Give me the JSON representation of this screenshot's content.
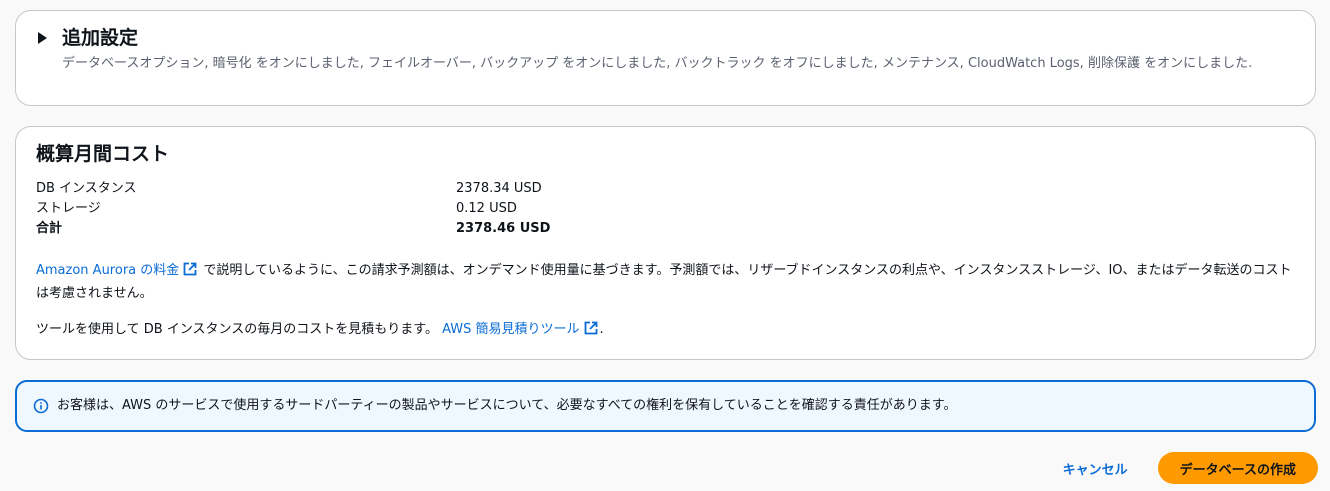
{
  "additional_settings": {
    "title": "追加設定",
    "description": "データベースオプション, 暗号化 をオンにしました, フェイルオーバー, バックアップ をオンにしました, バックトラック をオフにしました, メンテナンス, CloudWatch Logs, 削除保護 をオンにしました."
  },
  "cost": {
    "title": "概算月間コスト",
    "rows": [
      {
        "label": "DB インスタンス",
        "value": "2378.34 USD"
      },
      {
        "label": "ストレージ",
        "value": "0.12 USD"
      },
      {
        "label": "合計",
        "value": "2378.46 USD"
      }
    ],
    "note1_link": "Amazon Aurora の料金",
    "note1_text": " で説明しているように、この請求予測額は、オンデマンド使用量に基づきます。予測額では、リザーブドインスタンスの利点や、インスタンスストレージ、IO、またはデータ転送のコストは考慮されません。",
    "note2_text": "ツールを使用して DB インスタンスの毎月のコストを見積もります。 ",
    "note2_link": "AWS 簡易見積りツール",
    "note2_suffix": "."
  },
  "alert": {
    "text": "お客様は、AWS のサービスで使用するサードパーティーの製品やサービスについて、必要なすべての権利を保有していることを確認する責任があります。"
  },
  "actions": {
    "cancel_label": "キャンセル",
    "create_label": "データベースの作成"
  },
  "colors": {
    "link": "#0b6cd6",
    "primary_button": "#ff9900",
    "alert_border": "#0b6cd6",
    "alert_background": "#f0f8ff"
  },
  "icons": {
    "expander": "caret-right-icon",
    "external": "external-link-icon",
    "info": "info-circle-icon"
  }
}
